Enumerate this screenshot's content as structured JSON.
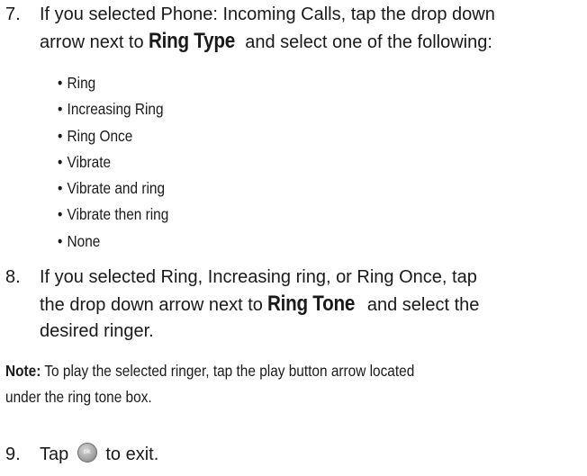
{
  "step7": {
    "number": "7.",
    "line1": "If you selected Phone: Incoming Calls, tap the drop down",
    "line2_pre": "arrow next to ",
    "line2_emph": "Ring Type",
    "line2_post": " and select one of the following:",
    "options": [
      "Ring",
      "Increasing Ring",
      "Ring Once",
      "Vibrate",
      "Vibrate and ring",
      "Vibrate then ring",
      "None"
    ]
  },
  "step8": {
    "number": "8.",
    "line1": "If you selected Ring, Increasing ring, or Ring Once, tap",
    "line2_pre": "the drop down arrow next to ",
    "line2_emph": "Ring Tone",
    "line2_post": " and select the",
    "line3": "desired ringer."
  },
  "note": {
    "label": "Note:",
    "line1": " To play the selected ringer, tap the play button arrow located",
    "line2": "under the ring tone box."
  },
  "step9": {
    "number": "9.",
    "pre": "Tap ",
    "icon": "ok-button-icon",
    "icon_text": "ok",
    "post": " to exit."
  }
}
